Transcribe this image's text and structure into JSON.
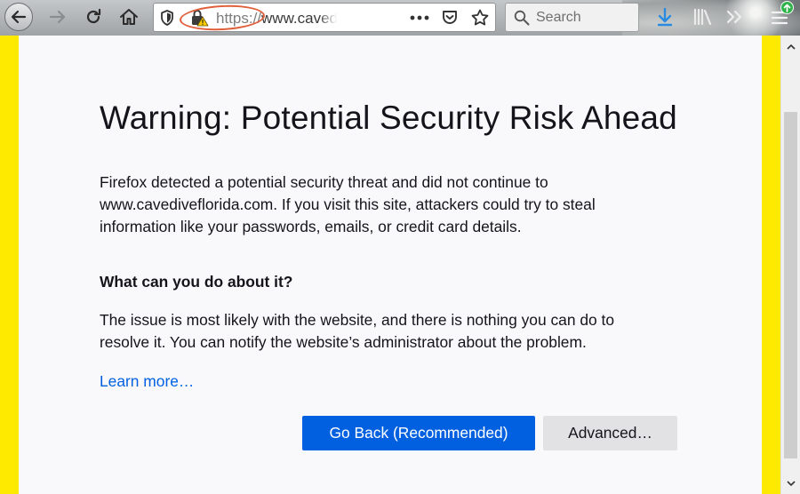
{
  "toolbar": {
    "url_scheme": "https://",
    "url_host": "www.cavediveflorida.com",
    "search_placeholder": "Search"
  },
  "page": {
    "title": "Warning: Potential Security Risk Ahead",
    "intro": "Firefox detected a potential security threat and did not continue to www.cavediveflorida.com. If you visit this site, attackers could try to steal information like your passwords, emails, or credit card details.",
    "what_heading": "What can you do about it?",
    "what_text": "The issue is most likely with the website, and there is nothing you can do to resolve it. You can notify the website’s administrator about the problem.",
    "learn_more": "Learn more…",
    "go_back_label": "Go Back (Recommended)",
    "advanced_label": "Advanced…"
  },
  "colors": {
    "accent_blue": "#0060df",
    "highlight_yellow": "#fdea00",
    "annotation_circle": "#e0603c",
    "update_badge": "#2fb34a"
  },
  "icons": [
    "back-icon",
    "forward-icon",
    "reload-icon",
    "home-icon",
    "tracking-shield-icon",
    "insecure-lock-icon",
    "page-actions-icon",
    "pocket-icon",
    "bookmark-star-icon",
    "search-icon",
    "download-icon",
    "library-icon",
    "overflow-icon",
    "hamburger-menu-icon",
    "update-badge-icon",
    "scroll-up-icon",
    "scroll-down-icon"
  ]
}
